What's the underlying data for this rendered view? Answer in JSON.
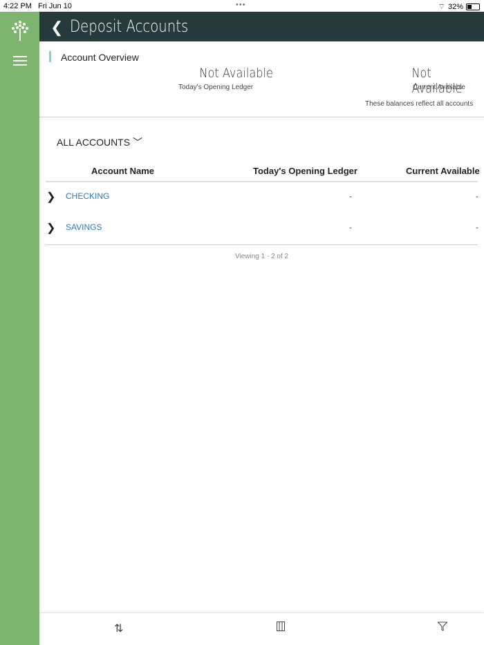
{
  "status": {
    "time": "4:22 PM",
    "date": "Fri Jun 10",
    "battery": "32%"
  },
  "header": {
    "title": "Deposit Accounts"
  },
  "overview": {
    "label": "Account Overview",
    "opening_value": "Not Available",
    "opening_label": "Today's Opening Ledger",
    "current_value": "Not Available",
    "current_label": "Current Available",
    "note": "These balances reflect all accounts"
  },
  "filter": {
    "label": "ALL ACCOUNTS"
  },
  "table": {
    "headers": [
      "Account Name",
      "Today's Opening Ledger",
      "Current Available"
    ],
    "rows": [
      {
        "name": "CHECKING",
        "opening": "-",
        "current": "-"
      },
      {
        "name": "SAVINGS",
        "opening": "-",
        "current": "-"
      }
    ],
    "footer": "Viewing 1 - 2 of 2"
  }
}
